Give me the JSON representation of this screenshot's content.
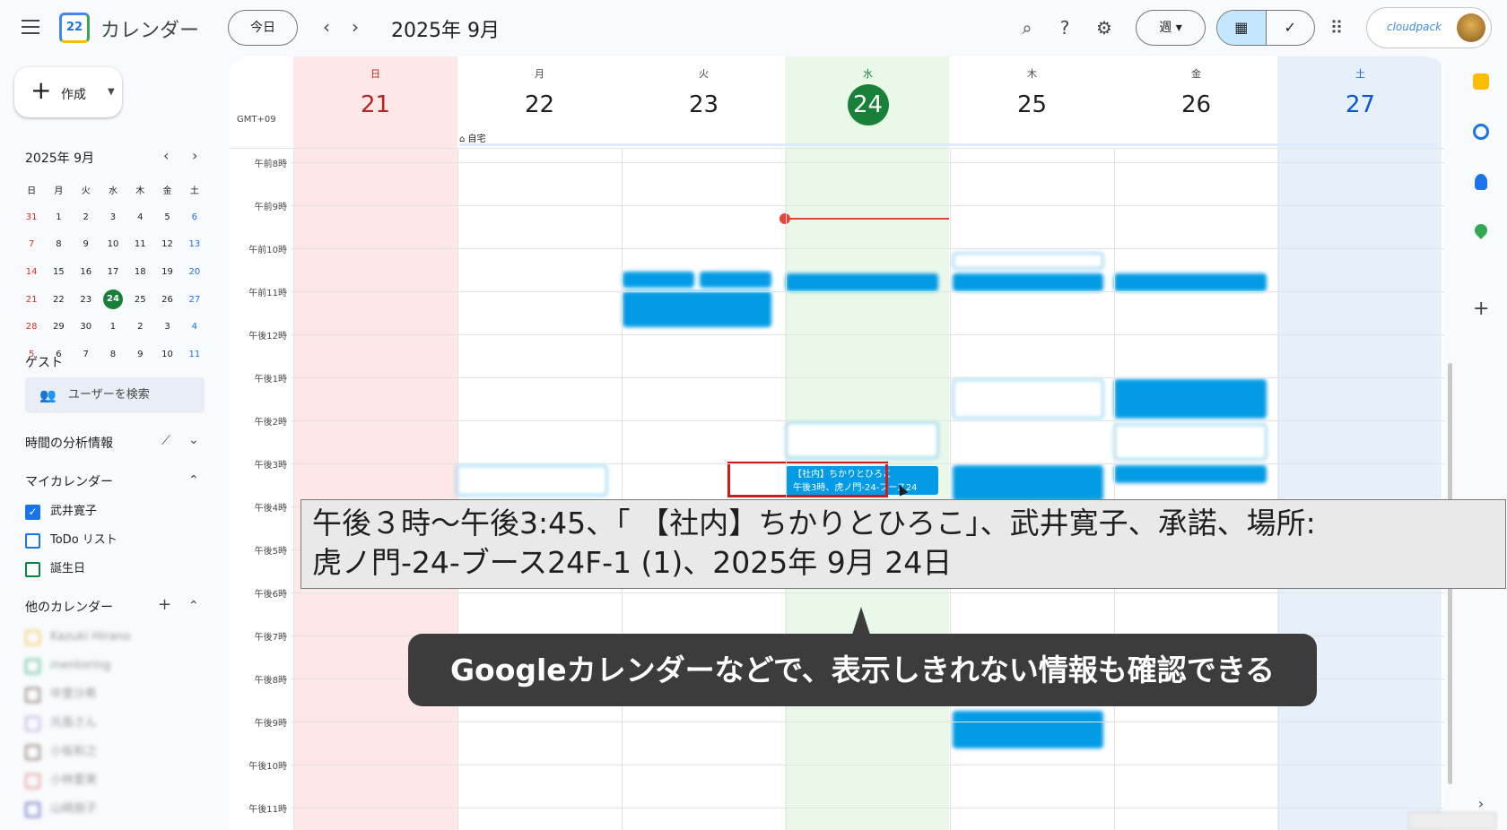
{
  "header": {
    "app_title": "カレンダー",
    "logo_day": "22",
    "today_label": "今日",
    "period": "2025年 9月",
    "view_label": "週",
    "account_brand": "cloudpack"
  },
  "sidebar": {
    "create_label": "作成",
    "mini_title": "2025年 9月",
    "weekdays": [
      "日",
      "月",
      "火",
      "水",
      "木",
      "金",
      "土"
    ],
    "weeks": [
      [
        "31",
        "1",
        "2",
        "3",
        "4",
        "5",
        "6"
      ],
      [
        "7",
        "8",
        "9",
        "10",
        "11",
        "12",
        "13"
      ],
      [
        "14",
        "15",
        "16",
        "17",
        "18",
        "19",
        "20"
      ],
      [
        "21",
        "22",
        "23",
        "24",
        "25",
        "26",
        "27"
      ],
      [
        "28",
        "29",
        "30",
        "1",
        "2",
        "3",
        "4"
      ],
      [
        "5",
        "6",
        "7",
        "8",
        "9",
        "10",
        "11"
      ]
    ],
    "today_date": "24",
    "guest_heading": "ゲスト",
    "guest_search_placeholder": "ユーザーを検索",
    "insights_heading": "時間の分析情報",
    "my_calendars_heading": "マイカレンダー",
    "my_calendars": [
      {
        "name": "武井寛子",
        "checked": true,
        "color": "#1a73e8"
      },
      {
        "name": "ToDo リスト",
        "checked": false,
        "color": "#1a73e8"
      },
      {
        "name": "誕生日",
        "checked": false,
        "color": "#0b8043"
      }
    ],
    "other_calendars_heading": "他のカレンダー",
    "other_calendars": [
      {
        "name": "Kazuki Hirano",
        "color": "#f6bf26"
      },
      {
        "name": "mentoring",
        "color": "#33b679"
      },
      {
        "name": "中里沙希",
        "color": "#795548"
      },
      {
        "name": "元島さん",
        "color": "#b39ddb"
      },
      {
        "name": "小坂和之",
        "color": "#795548"
      },
      {
        "name": "小林愛実",
        "color": "#e67c73"
      },
      {
        "name": "山崎朋子",
        "color": "#3f51b5"
      }
    ]
  },
  "week": {
    "timezone": "GMT+09",
    "days": [
      {
        "dow": "日",
        "date": "21",
        "kind": "sun"
      },
      {
        "dow": "月",
        "date": "22",
        "kind": ""
      },
      {
        "dow": "火",
        "date": "23",
        "kind": ""
      },
      {
        "dow": "水",
        "date": "24",
        "kind": "today"
      },
      {
        "dow": "木",
        "date": "25",
        "kind": ""
      },
      {
        "dow": "金",
        "date": "26",
        "kind": ""
      },
      {
        "dow": "土",
        "date": "27",
        "kind": "sat"
      }
    ],
    "allday_label": "自宅",
    "hours": [
      "午前8時",
      "午前9時",
      "午前10時",
      "午前11時",
      "午後12時",
      "午後1時",
      "午後2時",
      "午後3時",
      "午後4時",
      "午後5時",
      "午後6時",
      "午後7時",
      "午後8時",
      "午後9時",
      "午後10時",
      "午後11時"
    ],
    "focused_event": {
      "title": "【社内】ちかりとひろこ",
      "time": "午後3時、虎ノ門-24-ブース24"
    }
  },
  "tooltip": {
    "line1": "午後３時～午後3:45、「 【社内】ちかりとひろこ」、武井寛子、承諾、場所:",
    "line2": "虎ノ門-24-ブース24F-1 (1)、2025年 9月 24日"
  },
  "caption": "Googleカレンダーなどで、表示しきれない情報も確認できる",
  "colors": {
    "event_blue": "#039be5",
    "today_green": "#188038",
    "now_red": "#ea4335",
    "highlight_red": "#cc1c1c"
  }
}
